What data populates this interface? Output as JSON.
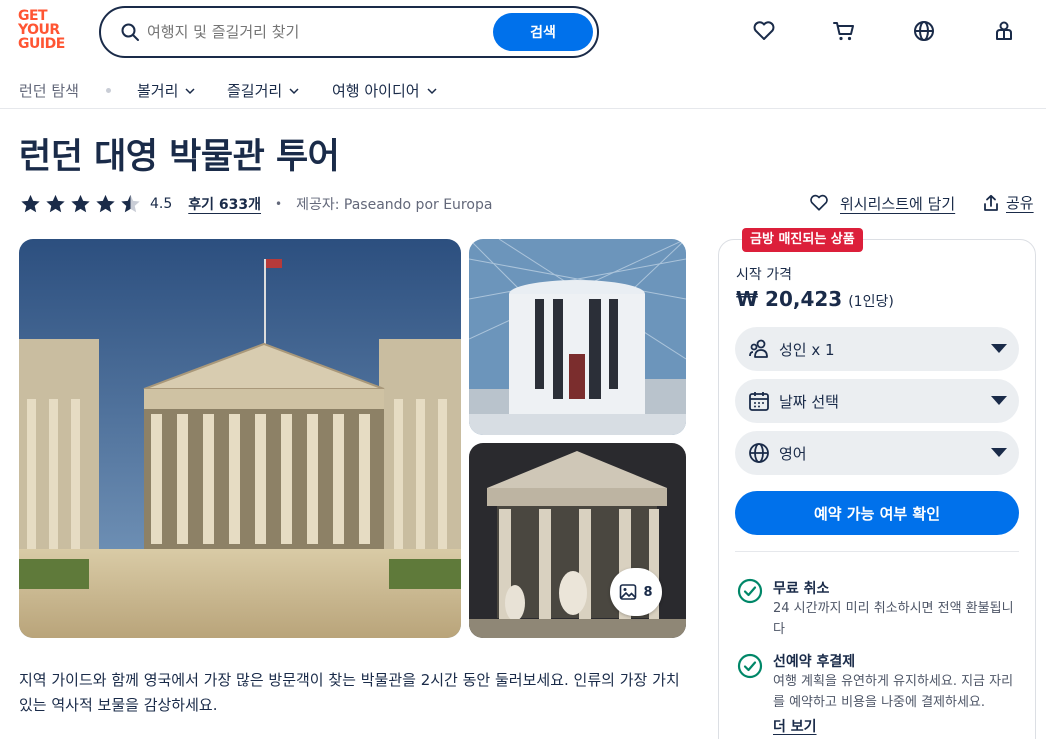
{
  "header": {
    "logo": [
      "GET",
      "YOUR",
      "GUIDE"
    ],
    "search_placeholder": "여행지 및 즐길거리 찾기",
    "search_button": "검색",
    "icons": [
      "heart-icon",
      "cart-icon",
      "globe-icon",
      "profile-icon"
    ]
  },
  "nav": {
    "items": [
      {
        "label": "런던 탐색",
        "has_dropdown": false
      },
      {
        "label": "볼거리",
        "has_dropdown": true
      },
      {
        "label": "즐길거리",
        "has_dropdown": true
      },
      {
        "label": "여행 아이디어",
        "has_dropdown": true
      }
    ]
  },
  "product": {
    "title": "런던 대영 박물관 투어",
    "rating": "4.5",
    "rating_stars": 4.5,
    "reviews_label": "후기 633개",
    "separator": "•",
    "provider": "제공자: Paseando por Europa",
    "wishlist_label": "위시리스트에 담기",
    "share_label": "공유",
    "gallery_count": "8",
    "description": "지역 가이드와 함께 영국에서 가장 많은 방문객이 찾는 박물관을 2시간 동안 둘러보세요. 인류의 가장 가치 있는 역사적 보물을 감상하세요."
  },
  "booking": {
    "badge": "금방 매진되는 상품",
    "price_label": "시작 가격",
    "price": "₩ 20,423",
    "price_unit": "(1인당)",
    "participants": "성인 x 1",
    "date": "날짜 선택",
    "language": "영어",
    "check_button": "예약 가능 여부 확인",
    "features": [
      {
        "title": "무료 취소",
        "text": "24 시간까지 미리 취소하시면 전액 환불됩니다"
      },
      {
        "title": "선예약 후결제",
        "text": "여행 계획을 유연하게 유지하세요. 지금 자리를 예약하고 비용을 나중에 결제하세요."
      }
    ],
    "more_label": "더 보기"
  },
  "colors": {
    "brand": "#ff5533",
    "primary": "#0071eb",
    "promo": "#dc1f3a",
    "text": "#1a2b49",
    "success": "#008768"
  }
}
